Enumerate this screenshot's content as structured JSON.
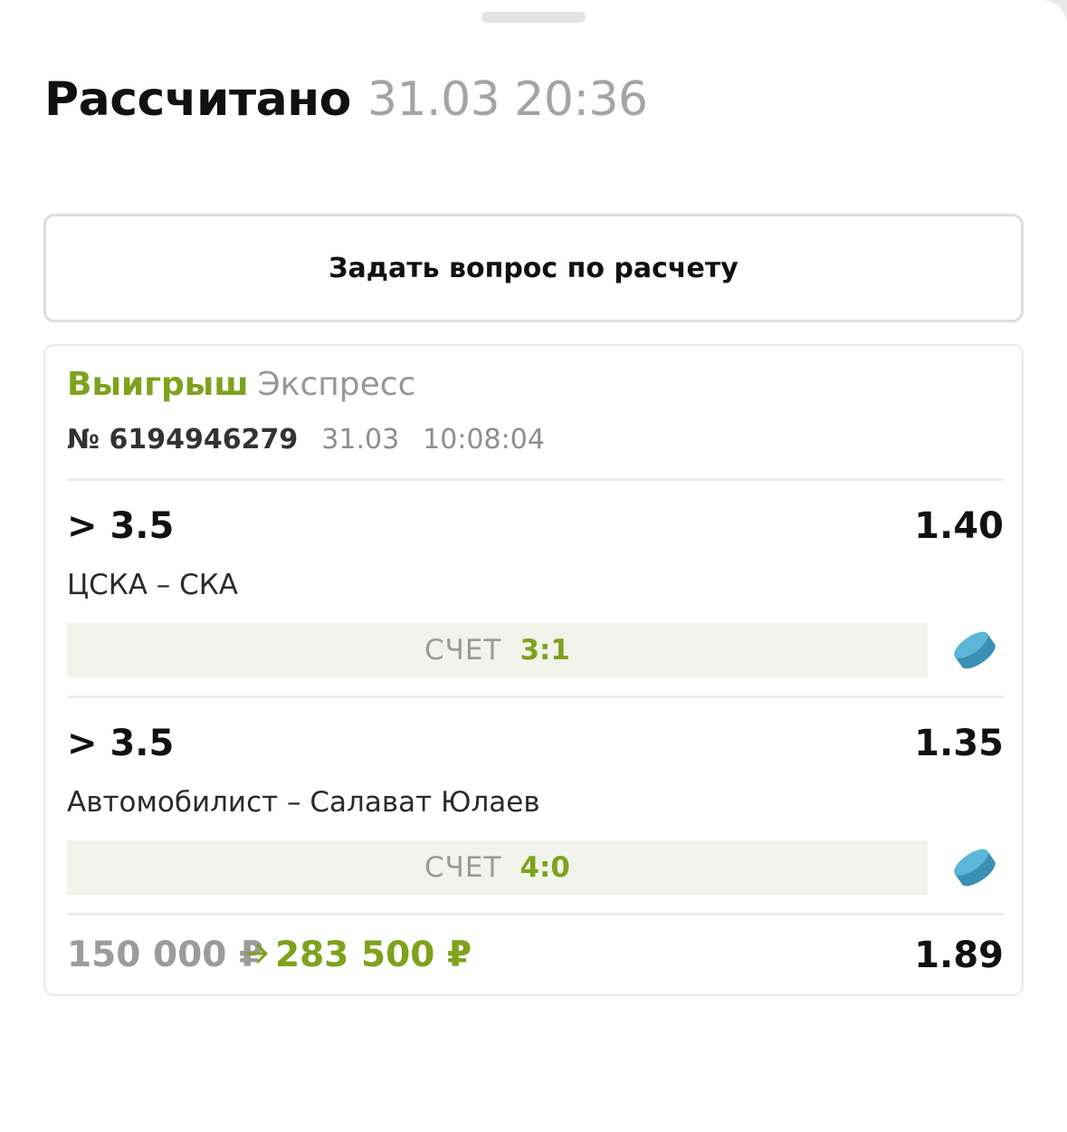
{
  "header": {
    "title": "Рассчитано",
    "datetime": "31.03 20:36"
  },
  "ask_button": {
    "label": "Задать вопрос по расчету"
  },
  "bet": {
    "status": "Выигрыш",
    "type": "Экспресс",
    "number": "№ 6194946279",
    "date": "31.03",
    "time": "10:08:04",
    "events": [
      {
        "selection": "> 3.5",
        "odds": "1.40",
        "teams": "ЦСКА – СКА",
        "score_label": "СЧЕТ",
        "score": "3:1",
        "sport_icon": "hockey-puck-icon"
      },
      {
        "selection": "> 3.5",
        "odds": "1.35",
        "teams": "Автомобилист – Салават Юлаев",
        "score_label": "СЧЕТ",
        "score": "4:0",
        "sport_icon": "hockey-puck-icon"
      }
    ],
    "stake": "150 000 ₽",
    "payout": "283 500 ₽",
    "total_odds": "1.89"
  },
  "colors": {
    "win": "#7ea21c",
    "muted": "#9b9b9b",
    "puck": "#4aa3c6",
    "score_bg": "#f2f3ea"
  }
}
